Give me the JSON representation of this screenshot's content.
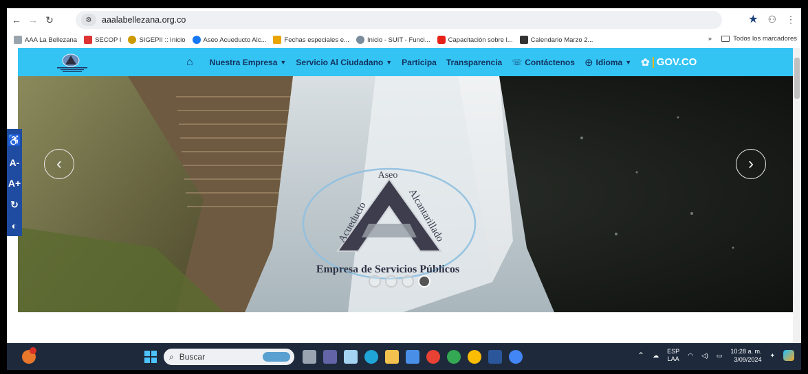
{
  "browser": {
    "url": "aaalabellezana.org.co",
    "bookmarks": [
      {
        "label": "AAA La Bellezana",
        "color": "#9aa4ad"
      },
      {
        "label": "SECOP I",
        "color": "#d33"
      },
      {
        "label": "SIGEPII :: Inicio",
        "color": "#c90"
      },
      {
        "label": "Aseo Acueducto Alc...",
        "color": "#1877f2"
      },
      {
        "label": "Fechas especiales e...",
        "color": "#e9a400"
      },
      {
        "label": "Inicio - SUIT - Funci...",
        "color": "#7a8c9c"
      },
      {
        "label": "Capacitación sobre l...",
        "color": "#e62117"
      },
      {
        "label": "Calendario Marzo 2...",
        "color": "#333"
      }
    ],
    "more_bookmarks": "»",
    "all_bookmarks": "Todos los marcadores"
  },
  "site": {
    "nav": [
      {
        "label": "Nuestra Empresa",
        "dropdown": true
      },
      {
        "label": "Servicio Al Ciudadano",
        "dropdown": true
      },
      {
        "label": "Participa",
        "dropdown": false
      },
      {
        "label": "Transparencia",
        "dropdown": false
      },
      {
        "label": "Contáctenos",
        "dropdown": false
      },
      {
        "label": "Idioma",
        "dropdown": true
      }
    ],
    "gov_label": "GOV.CO",
    "hero": {
      "logo_top": "Aseo",
      "logo_left": "Acueducto",
      "logo_right": "Alcantarillado",
      "logo_bottom": "Empresa de Servicios Públicos",
      "slide_count": 4,
      "active_slide": 4
    },
    "a11y": [
      "A-",
      "A+"
    ]
  },
  "taskbar": {
    "search_placeholder": "Buscar",
    "lang_top": "ESP",
    "lang_bottom": "LAA",
    "time": "10:28 a. m.",
    "date": "3/09/2024"
  },
  "colors": {
    "header": "#33c4f4",
    "nav_text": "#13325e",
    "a11y": "#1f4ca1",
    "taskbar": "#1e2a3c"
  }
}
